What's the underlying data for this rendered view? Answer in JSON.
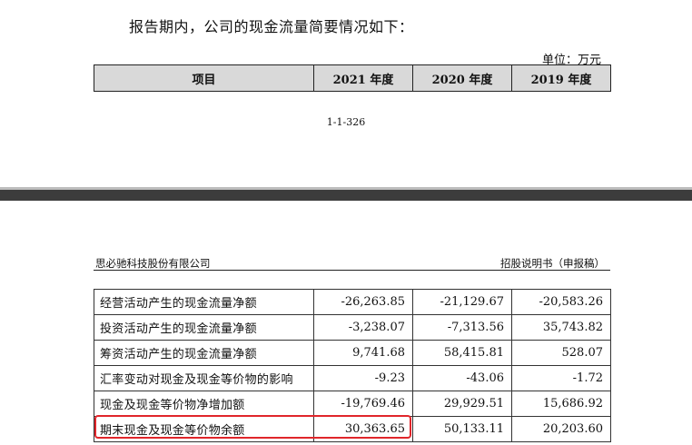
{
  "intro_text": "报告期内，公司的现金流量简要情况如下：",
  "unit_label": "单位：万元",
  "header_table": {
    "columns": [
      "项目",
      "2021 年度",
      "2020 年度",
      "2019 年度"
    ]
  },
  "page_number": "1-1-326",
  "company_name": "思必驰科技股份有限公司",
  "document_type": "招股说明书（申报稿）",
  "rows": [
    {
      "label": "经营活动产生的现金流量净额",
      "y2021": "-26,263.85",
      "y2020": "-21,129.67",
      "y2019": "-20,583.26"
    },
    {
      "label": "投资活动产生的现金流量净额",
      "y2021": "-3,238.07",
      "y2020": "-7,313.56",
      "y2019": "35,743.82"
    },
    {
      "label": "筹资活动产生的现金流量净额",
      "y2021": "9,741.68",
      "y2020": "58,415.81",
      "y2019": "528.07"
    },
    {
      "label": "汇率变动对现金及现金等价物的影响",
      "y2021": "-9.23",
      "y2020": "-43.06",
      "y2019": "-1.72"
    },
    {
      "label": "现金及现金等价物净增加额",
      "y2021": "-19,769.46",
      "y2020": "29,929.51",
      "y2019": "15,686.92"
    },
    {
      "label": "期末现金及现金等价物余额",
      "y2021": "30,363.65",
      "y2020": "50,133.11",
      "y2019": "20,203.60"
    }
  ],
  "highlight_color": "#e0262b"
}
